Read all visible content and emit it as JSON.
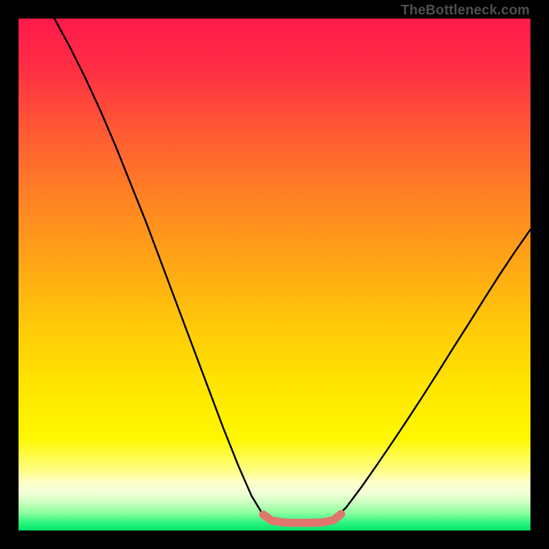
{
  "watermark": "TheBottleneck.com",
  "colors": {
    "stops": [
      {
        "offset": 0.0,
        "hex": "#ff1a4b"
      },
      {
        "offset": 0.1,
        "hex": "#ff2f44"
      },
      {
        "offset": 0.22,
        "hex": "#ff5a33"
      },
      {
        "offset": 0.35,
        "hex": "#ff8224"
      },
      {
        "offset": 0.48,
        "hex": "#ffa615"
      },
      {
        "offset": 0.6,
        "hex": "#ffc908"
      },
      {
        "offset": 0.72,
        "hex": "#ffe600"
      },
      {
        "offset": 0.82,
        "hex": "#fff700"
      },
      {
        "offset": 0.885,
        "hex": "#ffff8a"
      },
      {
        "offset": 0.905,
        "hex": "#ffffc8"
      },
      {
        "offset": 0.925,
        "hex": "#f3ffd8"
      },
      {
        "offset": 0.945,
        "hex": "#ccffc1"
      },
      {
        "offset": 0.965,
        "hex": "#8effa0"
      },
      {
        "offset": 0.985,
        "hex": "#2cf57f"
      },
      {
        "offset": 1.0,
        "hex": "#00e56a"
      }
    ],
    "curve": "#000000",
    "marker": "#e0766d"
  },
  "chart_data": {
    "type": "line",
    "title": "",
    "xlabel": "",
    "ylabel": "",
    "xlim": [
      0,
      100
    ],
    "ylim": [
      0,
      100
    ],
    "series": [
      {
        "name": "left-branch",
        "x": [
          7,
          10,
          13,
          16,
          19,
          22,
          25,
          28,
          31,
          34,
          37,
          40,
          43,
          45.5,
          47.5,
          49.5
        ],
        "y": [
          100,
          94.5,
          88.5,
          82.0,
          75.0,
          67.5,
          60.0,
          52.0,
          44.0,
          36.0,
          28.0,
          20.0,
          12.5,
          6.8,
          3.5,
          1.9
        ]
      },
      {
        "name": "flat-bottom",
        "x": [
          49.5,
          51.5,
          53.5,
          55.5,
          57.5,
          59.5,
          61.5
        ],
        "y": [
          1.9,
          1.6,
          1.5,
          1.5,
          1.5,
          1.6,
          2.0
        ]
      },
      {
        "name": "right-branch",
        "x": [
          61.5,
          64,
          67,
          70,
          73,
          76,
          79,
          82,
          85,
          88,
          91,
          94,
          97,
          100
        ],
        "y": [
          2.0,
          4.5,
          8.5,
          12.8,
          17.2,
          21.7,
          26.3,
          31.0,
          35.8,
          40.5,
          45.3,
          50.0,
          54.5,
          58.8
        ]
      }
    ],
    "marker": {
      "name": "bottom-marker",
      "x": [
        47.8,
        49.5,
        51.5,
        53.5,
        55.5,
        57.5,
        59.5,
        61.5,
        63.0
      ],
      "y": [
        3.1,
        1.9,
        1.6,
        1.5,
        1.5,
        1.5,
        1.6,
        2.0,
        3.2
      ]
    }
  }
}
